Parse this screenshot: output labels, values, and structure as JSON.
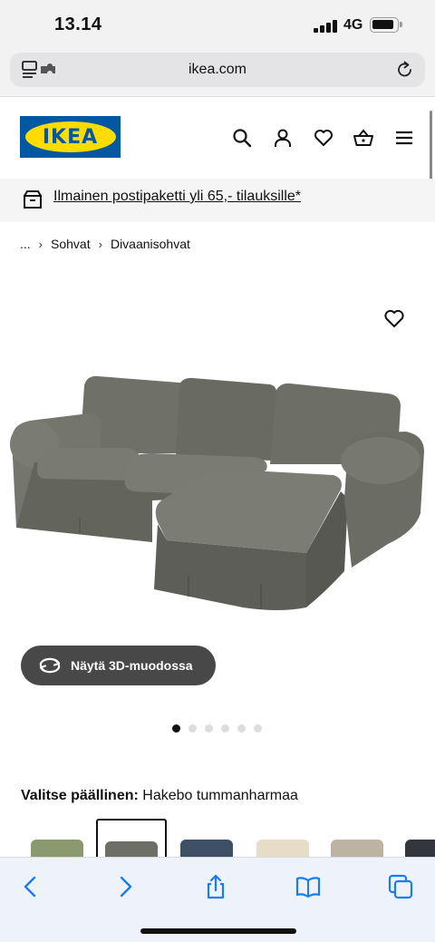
{
  "status_bar": {
    "time": "13.14",
    "network": "4G"
  },
  "browser": {
    "url": "ikea.com"
  },
  "header": {
    "logo_text": "IKEA"
  },
  "promo": {
    "text": "Ilmainen postipaketti yli 65,- tilauksille*"
  },
  "breadcrumb": {
    "ellipsis": "...",
    "items": [
      "Sohvat",
      "Divaanisohvat"
    ]
  },
  "product": {
    "view_3d_label": "Näytä 3D-muodossa",
    "image_dots": {
      "total": 6,
      "active": 0
    },
    "cover_label": "Valitse päällinen:",
    "cover_value": "Hakebo tummanharmaa",
    "swatches": [
      {
        "color": "#8a9a6e",
        "selected": false
      },
      {
        "color": "#6d6f66",
        "selected": true
      },
      {
        "color": "#3f4f66",
        "selected": false
      },
      {
        "color": "#e6dcc8",
        "selected": false
      },
      {
        "color": "#bdb3a3",
        "selected": false
      },
      {
        "color": "#33373d",
        "selected": false
      }
    ]
  },
  "colors": {
    "ikea_blue": "#0058a3",
    "ikea_yellow": "#ffdb00",
    "safari_blue": "#1a7cf5",
    "sofa_grey": "#6b6c64"
  }
}
